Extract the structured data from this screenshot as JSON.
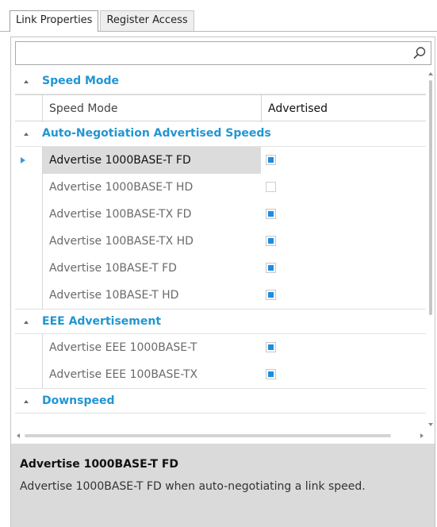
{
  "tabs": [
    {
      "label": "Link Properties",
      "active": true
    },
    {
      "label": "Register Access",
      "active": false
    }
  ],
  "search": {
    "value": "",
    "placeholder": ""
  },
  "categories": [
    {
      "title": "Speed Mode",
      "expanded": true,
      "properties": [
        {
          "name": "Speed Mode",
          "value": "Advertised"
        }
      ]
    },
    {
      "title": "Auto-Negotiation Advertised Speeds",
      "expanded": true,
      "properties": [
        {
          "name": "Advertise 1000BASE-T FD",
          "checked": true,
          "selected": true
        },
        {
          "name": "Advertise 1000BASE-T HD",
          "checked": false
        },
        {
          "name": "Advertise 100BASE-TX FD",
          "checked": true
        },
        {
          "name": "Advertise 100BASE-TX HD",
          "checked": true
        },
        {
          "name": "Advertise 10BASE-T FD",
          "checked": true
        },
        {
          "name": "Advertise 10BASE-T HD",
          "checked": true
        }
      ]
    },
    {
      "title": "EEE Advertisement",
      "expanded": true,
      "properties": [
        {
          "name": "Advertise EEE 1000BASE-T",
          "checked": true
        },
        {
          "name": "Advertise EEE 100BASE-TX",
          "checked": true
        }
      ]
    },
    {
      "title": "Downspeed",
      "expanded": true,
      "properties": []
    }
  ],
  "description": {
    "title": "Advertise 1000BASE-T FD",
    "text": "Advertise 1000BASE-T FD when auto-negotiating a link speed."
  },
  "icons": {
    "search": "search-icon",
    "collapse": "collapse-triangle-icon",
    "selected_row": "row-selector-icon"
  },
  "colors": {
    "category_title": "#2196d3",
    "checkbox_fill": "#1e8de0",
    "selected_row": "#dcdcdc",
    "description_bg": "#dadada"
  }
}
